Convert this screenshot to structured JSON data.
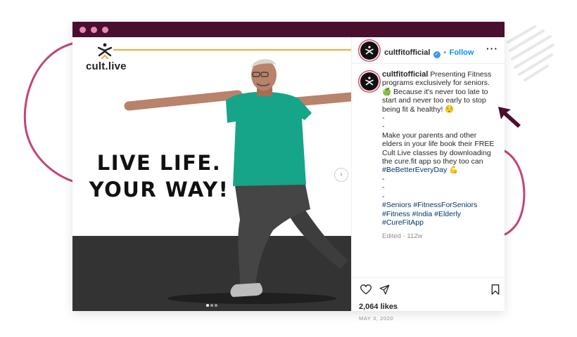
{
  "colors": {
    "titlebar": "#4a0f2f",
    "accent": "#f2a93b",
    "link": "#0095f6",
    "hashtag": "#00376b",
    "deco": "#c2447a"
  },
  "post_image": {
    "logo_text": "cult.live",
    "headline_line1": "LIVE LIFE.",
    "headline_line2": "YOUR WAY!",
    "next_icon": "chevron-right-icon",
    "page_indicator": {
      "total": 3,
      "current": 1
    }
  },
  "header": {
    "username": "cultfitofficial",
    "verified_icon": "verified-badge-icon",
    "separator": "•",
    "follow_label": "Follow",
    "more_label": "···"
  },
  "caption": {
    "username": "cultfitofficial",
    "text1": "Presenting Fitness programs exclusively for seniors. 🍏 Because it's never too late to start and never too early to stop being fit & healthy! 😌",
    "dash1": "-",
    "dash2": "-",
    "text2": "Make your parents and other elders in your life book their FREE Cult Live classes by downloading the cure.fit app so they too can",
    "hashtag_main": "#BeBetterEveryDay",
    "emoji2": "💪",
    "dash3": "-",
    "dash4": "-",
    "dash5": "-",
    "hashtags_line1": "#Seniors #FitnessForSeniors",
    "hashtags_line2": "#Fitness #India #Elderly",
    "hashtags_line3": "#CureFitApp",
    "edited": "Edited · 112w"
  },
  "actions": {
    "like_icon": "heart-icon",
    "share_icon": "send-icon",
    "save_icon": "bookmark-icon"
  },
  "likes": "2,064 likes",
  "date": "MAY 3, 2020"
}
